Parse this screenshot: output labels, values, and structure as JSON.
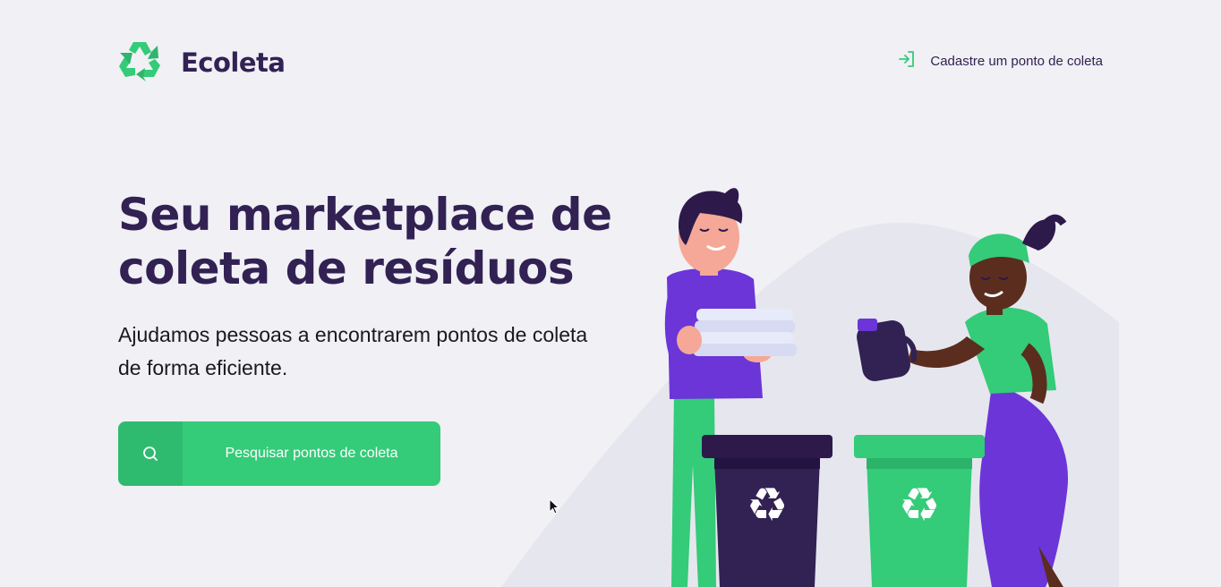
{
  "header": {
    "logo_text": "Ecoleta",
    "register_link": "Cadastre um ponto de coleta"
  },
  "hero": {
    "title_line1": "Seu marketplace de",
    "title_line2": "coleta de resíduos",
    "subtitle_line1": "Ajudamos pessoas a encontrarem pontos de coleta",
    "subtitle_line2": "de forma eficiente."
  },
  "search": {
    "label": "Pesquisar pontos de coleta",
    "icon": "search-icon"
  },
  "colors": {
    "primary": "#34cb79",
    "title": "#322153",
    "background": "#f0f0f5"
  }
}
